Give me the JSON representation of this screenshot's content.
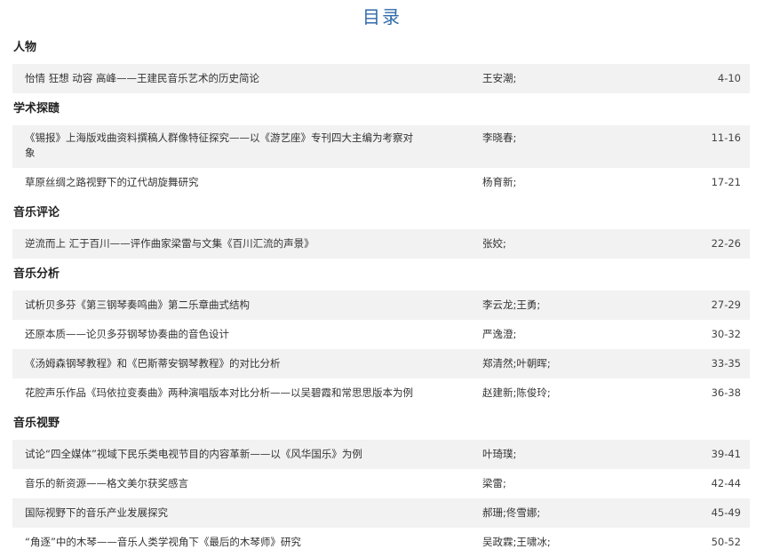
{
  "page_title": "目录",
  "sections": [
    {
      "title": "人物",
      "entries": [
        {
          "title": "怡情 狂想 动容 高峰——王建民音乐艺术的历史简论",
          "authors": "王安潮;",
          "pages": "4-10"
        }
      ]
    },
    {
      "title": "学术探赜",
      "entries": [
        {
          "title": "《锡报》上海版戏曲资料撰稿人群像特征探究——以《游艺座》专刊四大主编为考察对象",
          "authors": "李晓春;",
          "pages": "11-16"
        },
        {
          "title": "草原丝绸之路视野下的辽代胡旋舞研究",
          "authors": "杨育新;",
          "pages": "17-21"
        }
      ]
    },
    {
      "title": "音乐评论",
      "entries": [
        {
          "title": "逆流而上 汇于百川——评作曲家梁雷与文集《百川汇流的声景》",
          "authors": "张姣;",
          "pages": "22-26"
        }
      ]
    },
    {
      "title": "音乐分析",
      "entries": [
        {
          "title": "试析贝多芬《第三钢琴奏鸣曲》第二乐章曲式结构",
          "authors": "李云龙;王勇;",
          "pages": "27-29"
        },
        {
          "title": "还原本质——论贝多芬钢琴协奏曲的音色设计",
          "authors": "严逸澄;",
          "pages": "30-32"
        },
        {
          "title": "《汤姆森钢琴教程》和《巴斯蒂安钢琴教程》的对比分析",
          "authors": "郑清然;叶朝晖;",
          "pages": "33-35"
        },
        {
          "title": "花腔声乐作品《玛依拉变奏曲》两种演唱版本对比分析——以吴碧霞和常思思版本为例",
          "authors": "赵建新;陈俊玲;",
          "pages": "36-38"
        }
      ]
    },
    {
      "title": "音乐视野",
      "entries": [
        {
          "title": "试论“四全媒体”视域下民乐类电视节目的内容革新——以《风华国乐》为例",
          "authors": "叶琦璞;",
          "pages": "39-41"
        },
        {
          "title": "音乐的新资源——格文美尔获奖感言",
          "authors": "梁雷;",
          "pages": "42-44"
        },
        {
          "title": "国际视野下的音乐产业发展探究",
          "authors": "郝珊;佟雪娜;",
          "pages": "45-49"
        },
        {
          "title": "“角逐”中的木琴——音乐人类学视角下《最后的木琴师》研究",
          "authors": "吴政霖;王啸冰;",
          "pages": "50-52"
        }
      ]
    }
  ]
}
